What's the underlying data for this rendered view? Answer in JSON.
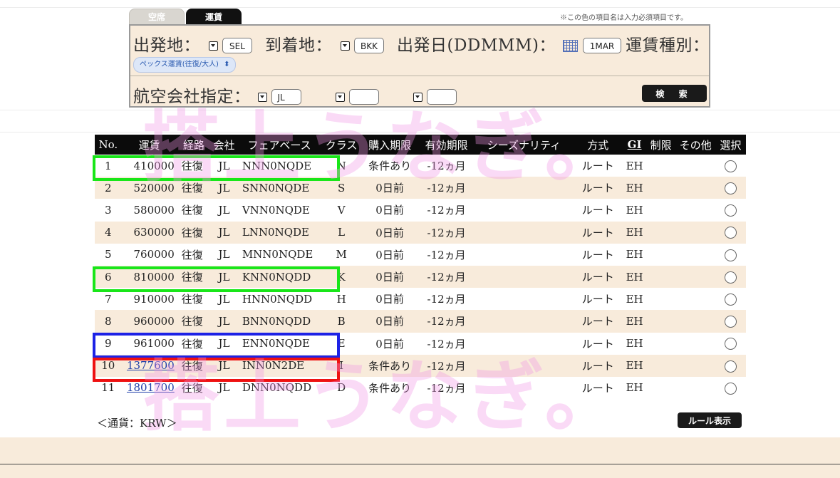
{
  "tabs": {
    "seat": "空席",
    "fare": "運賃"
  },
  "required_note": "※この色の項目名は入力必須項目です。",
  "search": {
    "origin_label": "出発地：",
    "origin_value": "SEL",
    "destination_label": "到着地：",
    "destination_value": "BKK",
    "date_label": "出発日(DDMMM)：",
    "date_value": "1MAR",
    "fare_type_label": "運賃種別：",
    "fare_type_value": "ペックス運賃(往復/大人)",
    "airline_label": "航空会社指定：",
    "airline_1": "JL",
    "airline_2": "",
    "airline_3": "",
    "search_button": "検 索"
  },
  "watermark": "搭上うなぎ。",
  "table": {
    "headers": [
      "No.",
      "運賃",
      "経路",
      "会社",
      "フェアベース",
      "クラス",
      "購入期限",
      "有効期限",
      "シーズナリティ",
      "方式",
      "GI",
      "制限",
      "その他",
      "選択"
    ],
    "rows": [
      {
        "no": "1",
        "fare": "410000",
        "route": "往復",
        "carrier": "JL",
        "basis": "NNN0NQDE",
        "class": "N",
        "purchase": "条件あり",
        "validity": "-12ヵ月",
        "seasonality": "",
        "method": "ルート",
        "gi": "EH",
        "restriction": "",
        "other": "",
        "link": false
      },
      {
        "no": "2",
        "fare": "520000",
        "route": "往復",
        "carrier": "JL",
        "basis": "SNN0NQDE",
        "class": "S",
        "purchase": "0日前",
        "validity": "-12ヵ月",
        "seasonality": "",
        "method": "ルート",
        "gi": "EH",
        "restriction": "",
        "other": "",
        "link": false
      },
      {
        "no": "3",
        "fare": "580000",
        "route": "往復",
        "carrier": "JL",
        "basis": "VNN0NQDE",
        "class": "V",
        "purchase": "0日前",
        "validity": "-12ヵ月",
        "seasonality": "",
        "method": "ルート",
        "gi": "EH",
        "restriction": "",
        "other": "",
        "link": false
      },
      {
        "no": "4",
        "fare": "630000",
        "route": "往復",
        "carrier": "JL",
        "basis": "LNN0NQDE",
        "class": "L",
        "purchase": "0日前",
        "validity": "-12ヵ月",
        "seasonality": "",
        "method": "ルート",
        "gi": "EH",
        "restriction": "",
        "other": "",
        "link": false
      },
      {
        "no": "5",
        "fare": "760000",
        "route": "往復",
        "carrier": "JL",
        "basis": "MNN0NQDE",
        "class": "M",
        "purchase": "0日前",
        "validity": "-12ヵ月",
        "seasonality": "",
        "method": "ルート",
        "gi": "EH",
        "restriction": "",
        "other": "",
        "link": false
      },
      {
        "no": "6",
        "fare": "810000",
        "route": "往復",
        "carrier": "JL",
        "basis": "KNN0NQDD",
        "class": "K",
        "purchase": "0日前",
        "validity": "-12ヵ月",
        "seasonality": "",
        "method": "ルート",
        "gi": "EH",
        "restriction": "",
        "other": "",
        "link": false
      },
      {
        "no": "7",
        "fare": "910000",
        "route": "往復",
        "carrier": "JL",
        "basis": "HNN0NQDD",
        "class": "H",
        "purchase": "0日前",
        "validity": "-12ヵ月",
        "seasonality": "",
        "method": "ルート",
        "gi": "EH",
        "restriction": "",
        "other": "",
        "link": false
      },
      {
        "no": "8",
        "fare": "960000",
        "route": "往復",
        "carrier": "JL",
        "basis": "BNN0NQDD",
        "class": "B",
        "purchase": "0日前",
        "validity": "-12ヵ月",
        "seasonality": "",
        "method": "ルート",
        "gi": "EH",
        "restriction": "",
        "other": "",
        "link": false
      },
      {
        "no": "9",
        "fare": "961000",
        "route": "往復",
        "carrier": "JL",
        "basis": "ENN0NQDE",
        "class": "E",
        "purchase": "0日前",
        "validity": "-12ヵ月",
        "seasonality": "",
        "method": "ルート",
        "gi": "EH",
        "restriction": "",
        "other": "",
        "link": false
      },
      {
        "no": "10",
        "fare": "1377600",
        "route": "往復",
        "carrier": "JL",
        "basis": "INN0N2DE",
        "class": "I",
        "purchase": "条件あり",
        "validity": "-12ヵ月",
        "seasonality": "",
        "method": "ルート",
        "gi": "EH",
        "restriction": "",
        "other": "",
        "link": true
      },
      {
        "no": "11",
        "fare": "1801700",
        "route": "往復",
        "carrier": "JL",
        "basis": "DNN0NQDD",
        "class": "D",
        "purchase": "条件あり",
        "validity": "-12ヵ月",
        "seasonality": "",
        "method": "ルート",
        "gi": "EH",
        "restriction": "",
        "other": "",
        "link": true
      }
    ]
  },
  "currency_note": "＜通貨：KRW＞",
  "rule_button": "ルール表示",
  "colors": {
    "row_alt": "#f8ebdb",
    "header_bg": "#0b0b0b",
    "highlight_green": "#19e619",
    "highlight_blue": "#1d22e6",
    "highlight_red": "#ee1111",
    "watermark": "#f096e6"
  }
}
